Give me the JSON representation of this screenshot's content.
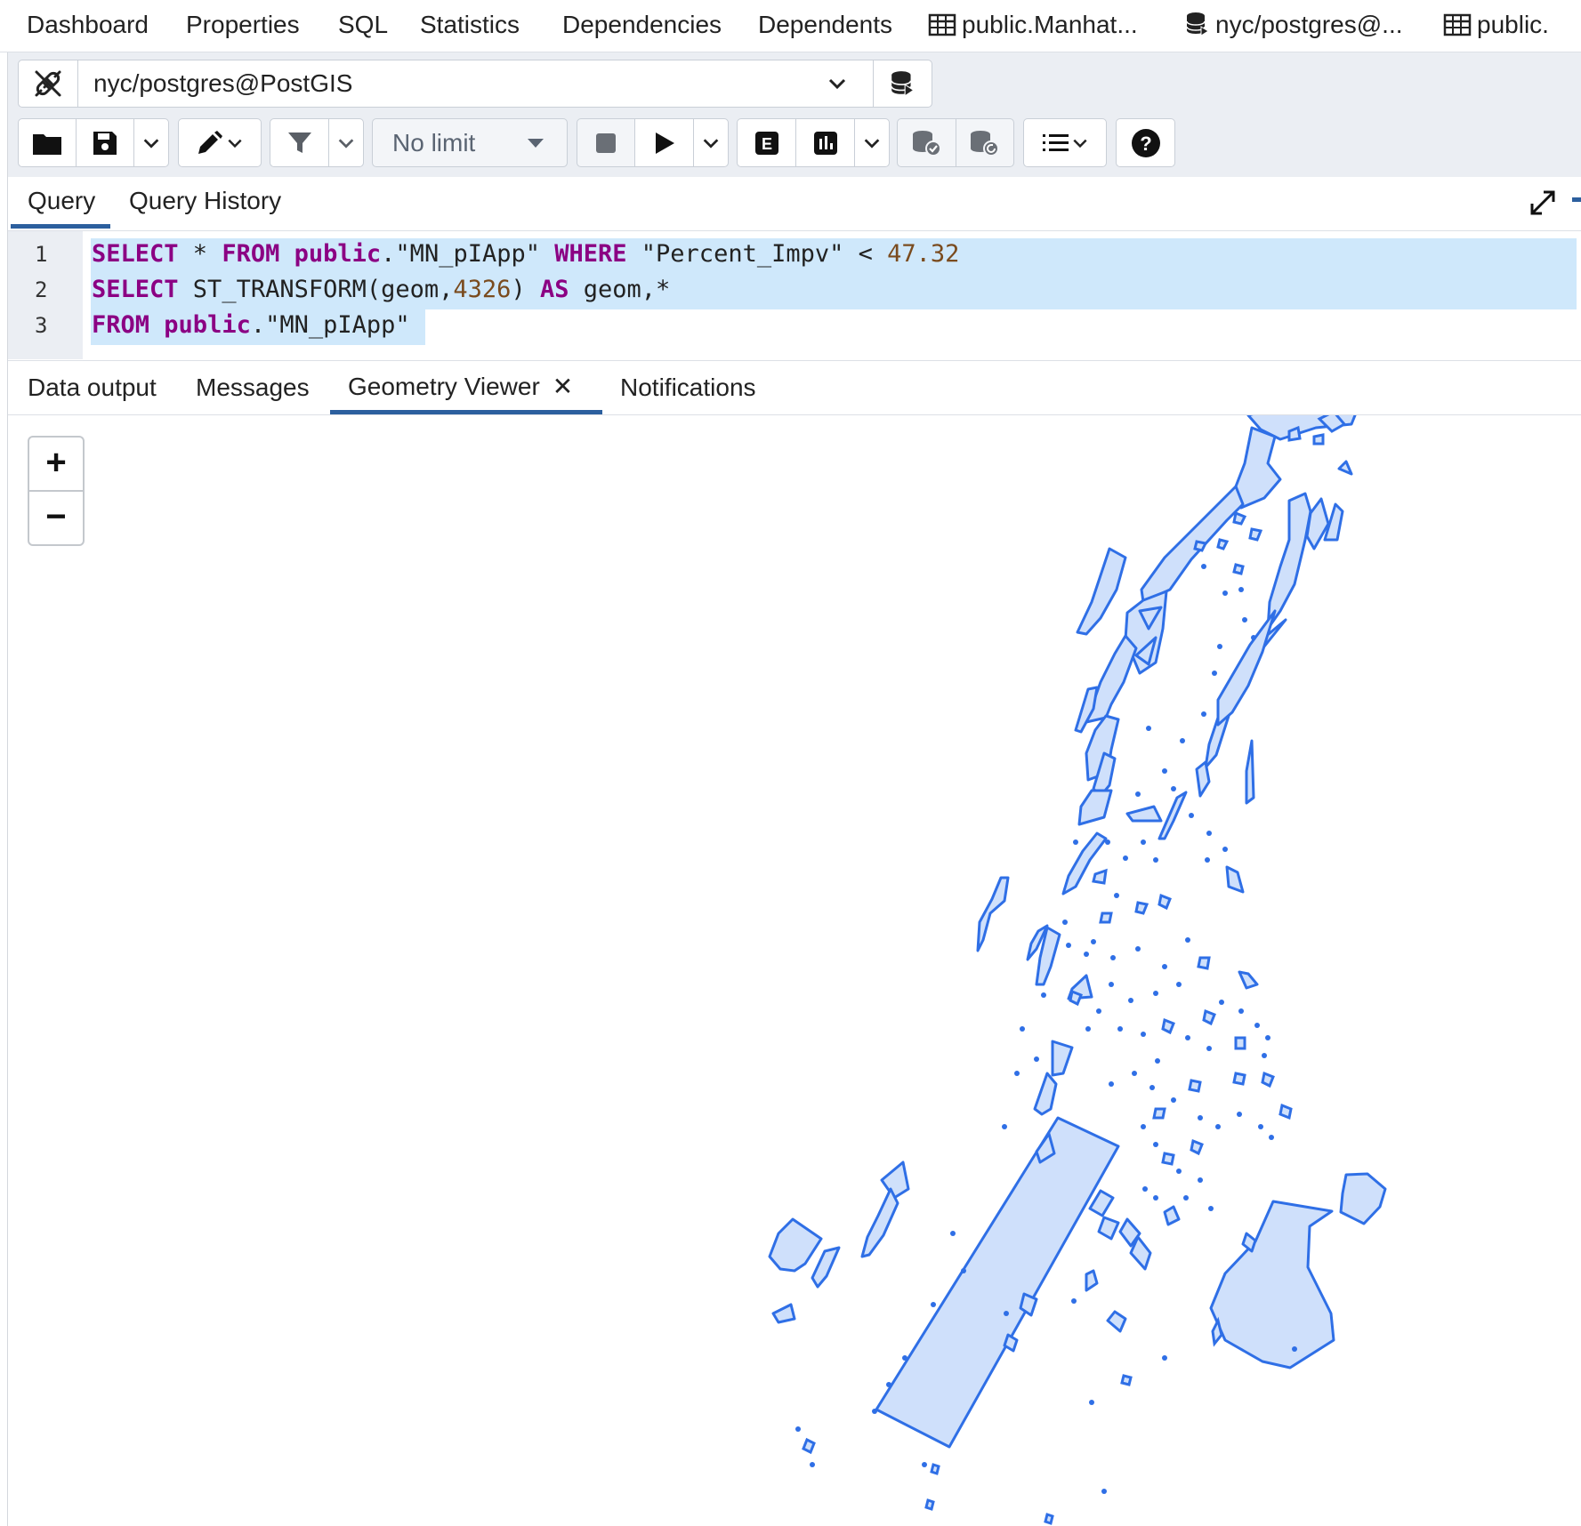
{
  "top_tabs": {
    "dashboard": "Dashboard",
    "properties": "Properties",
    "sql": "SQL",
    "statistics": "Statistics",
    "dependencies": "Dependencies",
    "dependents": "Dependents",
    "table_tab_1": "public.Manhat...",
    "connection_tab": "nyc/postgres@...",
    "table_tab_2": "public."
  },
  "connection": {
    "name": "nyc/postgres@PostGIS"
  },
  "toolbar": {
    "limit_label": "No limit"
  },
  "query_tabs": {
    "query": "Query",
    "history": "Query History"
  },
  "editor": {
    "line_numbers": [
      "1",
      "2",
      "3"
    ],
    "lines": [
      "SELECT * FROM public.\"MN_pIApp\" WHERE \"Percent_Impv\" < 47.32",
      "SELECT ST_TRANSFORM(geom,4326) AS geom,*",
      "FROM public.\"MN_pIApp\""
    ]
  },
  "result_tabs": {
    "data_output": "Data output",
    "messages": "Messages",
    "geometry_viewer": "Geometry Viewer",
    "notifications": "Notifications"
  },
  "map": {
    "zoom_in": "+",
    "zoom_out": "−",
    "stroke_color": "#2f6fe6",
    "fill_color": "#cfe0fb"
  },
  "colors": {
    "accent": "#2c5f9e",
    "toolbar_bg": "#ebeef3",
    "selection": "#cfe8fb",
    "keyword": "#8b0083",
    "number": "#7a4b1e"
  }
}
